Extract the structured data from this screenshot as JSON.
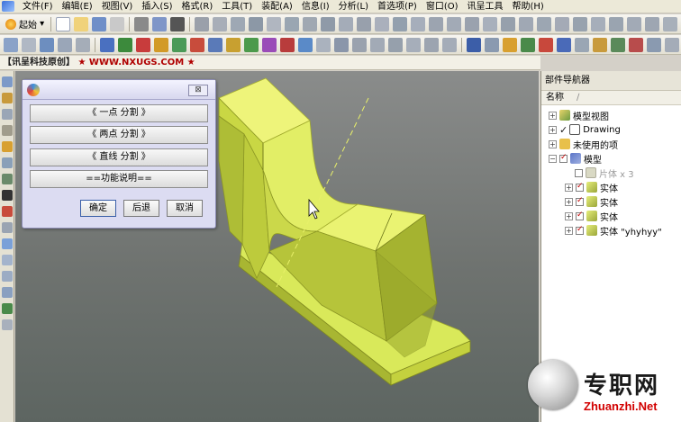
{
  "menu": [
    "文件(F)",
    "编辑(E)",
    "视图(V)",
    "插入(S)",
    "格式(R)",
    "工具(T)",
    "装配(A)",
    "信息(I)",
    "分析(L)",
    "首选项(P)",
    "窗口(O)",
    "讯呈工具",
    "帮助(H)"
  ],
  "toolbar": {
    "start_label": "起始"
  },
  "brand": {
    "company": "【讯呈科技原创】",
    "site": "★ WWW.NXUGS.COM ★"
  },
  "dialog": {
    "close_label": "⊠",
    "buttons": [
      "《 一点 分割 》",
      "《 两点 分割 》",
      "《 直线 分割 》",
      "==功能说明=="
    ],
    "ok_label": "确定",
    "back_label": "后退",
    "cancel_label": "取消"
  },
  "navigator": {
    "title": "部件导航器",
    "column_header": "名称",
    "column_sep": "∕",
    "items": [
      {
        "label": "模型视图"
      },
      {
        "label": "Drawing"
      },
      {
        "label": "未使用的项"
      },
      {
        "label": "模型"
      },
      {
        "label": "片体 x 3"
      },
      {
        "label": "实体"
      },
      {
        "label": "实体"
      },
      {
        "label": "实体"
      },
      {
        "label": "实体 \"yhyhyy\""
      }
    ]
  },
  "watermark": {
    "cn": "专职网",
    "en": "Zhuanzhi.Net"
  },
  "colors": {
    "model_top": "#e9f56e",
    "model_side": "#b9c63a",
    "model_dark": "#8f9b22",
    "viewport_bg": "#707471",
    "dialog_bg": "#dcdcf2"
  }
}
